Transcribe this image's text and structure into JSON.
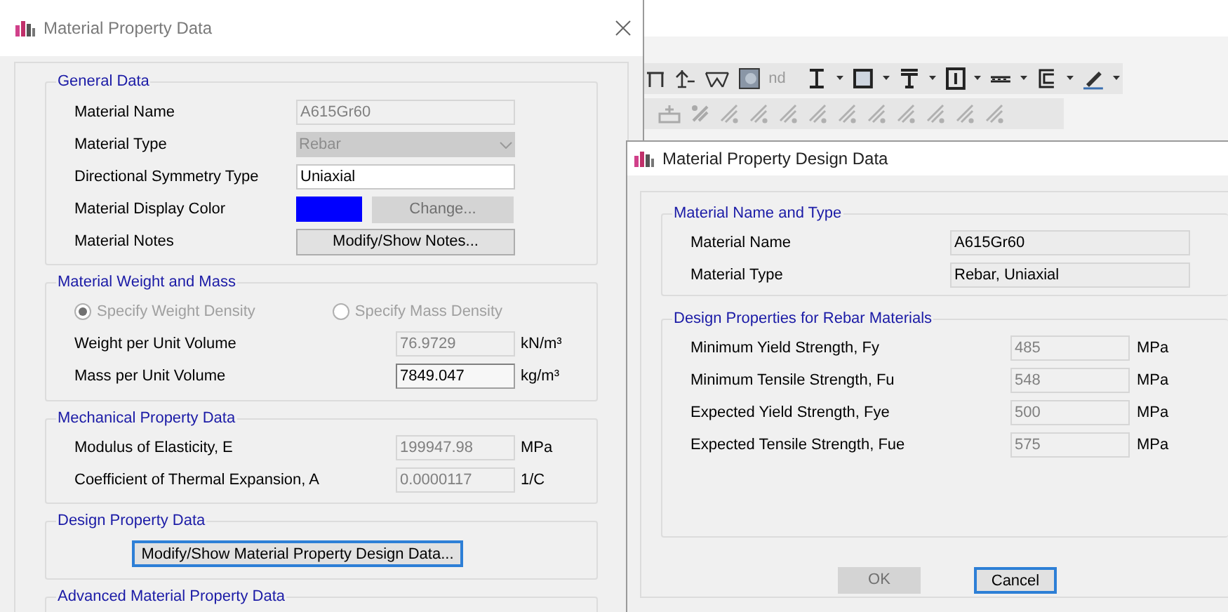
{
  "toolbar": {
    "partial_label": "nd"
  },
  "material_property_dialog": {
    "title": "Material Property Data",
    "general_data": {
      "title": "General Data",
      "rows": [
        {
          "label": "Material Name",
          "kind": "text",
          "value": "A615Gr60",
          "disabled": true
        },
        {
          "label": "Material Type",
          "kind": "dropdown",
          "value": "Rebar",
          "disabled": true
        },
        {
          "label": "Directional Symmetry Type",
          "kind": "text",
          "value": "Uniaxial",
          "disabled": false
        },
        {
          "label": "Material Display Color",
          "kind": "color",
          "color": "#0000ff",
          "button": "Change...",
          "disabled": true
        },
        {
          "label": "Material Notes",
          "kind": "button",
          "button": "Modify/Show Notes...",
          "disabled": false
        }
      ]
    },
    "weight_and_mass": {
      "title": "Material Weight and Mass",
      "radios": [
        {
          "label": "Specify Weight Density",
          "selected": true,
          "disabled": true
        },
        {
          "label": "Specify Mass Density",
          "selected": false,
          "disabled": true
        }
      ],
      "rows": [
        {
          "label": "Weight per Unit Volume",
          "value": "76.9729",
          "unit": "kN/m³",
          "disabled": true
        },
        {
          "label": "Mass per Unit Volume",
          "value": "7849.047",
          "unit": "kg/m³",
          "disabled": false
        }
      ]
    },
    "mechanical": {
      "title": "Mechanical Property Data",
      "rows": [
        {
          "label": "Modulus of Elasticity,  E",
          "value": "199947.98",
          "unit": "MPa",
          "disabled": true
        },
        {
          "label": "Coefficient of Thermal Expansion,  A",
          "value": "0.0000117",
          "unit": "1/C",
          "disabled": true
        }
      ]
    },
    "design": {
      "title": "Design Property Data",
      "button": "Modify/Show Material Property Design Data...",
      "focused": true
    },
    "advanced": {
      "title": "Advanced Material Property Data"
    }
  },
  "design_data_dialog": {
    "title": "Material Property Design Data",
    "name_and_type": {
      "title": "Material Name and Type",
      "rows": [
        {
          "label": "Material Name",
          "value": "A615Gr60"
        },
        {
          "label": "Material Type",
          "value": "Rebar, Uniaxial"
        }
      ]
    },
    "rebar_properties": {
      "title": "Design Properties for Rebar Materials",
      "rows": [
        {
          "label": "Minimum Yield Strength, Fy",
          "value": "485",
          "unit": "MPa",
          "disabled": true
        },
        {
          "label": "Minimum Tensile Strength, Fu",
          "value": "548",
          "unit": "MPa",
          "disabled": true
        },
        {
          "label": "Expected Yield Strength, Fye",
          "value": "500",
          "unit": "MPa",
          "disabled": true
        },
        {
          "label": "Expected Tensile Strength, Fue",
          "value": "575",
          "unit": "MPa",
          "disabled": true
        }
      ]
    },
    "buttons": [
      {
        "label": "OK",
        "disabled": true,
        "focused": false
      },
      {
        "label": "Cancel",
        "disabled": false,
        "focused": true
      }
    ]
  }
}
